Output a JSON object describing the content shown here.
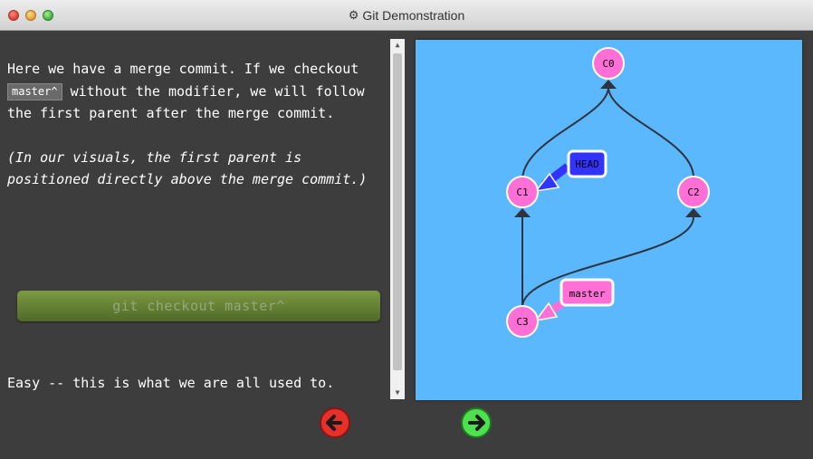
{
  "window": {
    "title": "Git Demonstration"
  },
  "text": {
    "p1_a": "Here we have a merge commit. If we checkout ",
    "p1_code": "master^",
    "p1_b": " without the modifier, we will follow the first parent after the merge commit.",
    "p2": "(In our visuals, the first parent is positioned directly above the merge commit.)",
    "easy": "Easy -- this is what we are all used to."
  },
  "command_button": {
    "label": "git checkout master^"
  },
  "graph": {
    "commits": [
      "C0",
      "C1",
      "C2",
      "C3"
    ],
    "edges": [
      [
        "C1",
        "C0"
      ],
      [
        "C2",
        "C0"
      ],
      [
        "C3",
        "C1"
      ],
      [
        "C3",
        "C2"
      ]
    ],
    "branches": [
      {
        "name": "HEAD",
        "target": "C1"
      },
      {
        "name": "master",
        "target": "C3"
      }
    ]
  },
  "colors": {
    "canvas": "#5cb8fd",
    "commit": "#ff6fd6",
    "head": "#3333ff",
    "master": "#ff6fd6",
    "edge": "#2d3440"
  },
  "nav": {
    "prev_icon": "arrow-left-icon",
    "next_icon": "arrow-right-icon"
  }
}
